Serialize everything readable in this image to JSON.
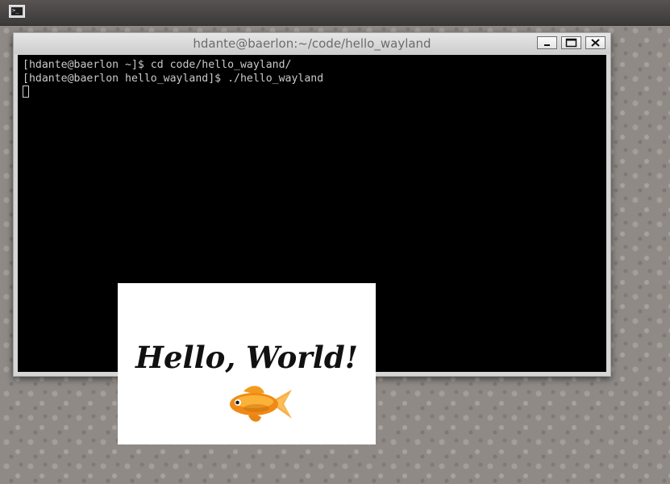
{
  "panel": {
    "launcher_glyph": ">_",
    "launcher_icon": "terminal-icon"
  },
  "terminal_window": {
    "title": "hdante@baerlon:~/code/hello_wayland",
    "buttons": {
      "minimize_icon": "minimize-icon",
      "maximize_icon": "maximize-icon",
      "close_icon": "close-icon"
    },
    "lines": [
      "[hdante@baerlon ~]$ cd code/hello_wayland/",
      "[hdante@baerlon hello_wayland]$ ./hello_wayland"
    ]
  },
  "hello_window": {
    "text": "Hello, World!",
    "image_icon": "goldfish-icon"
  },
  "colors": {
    "terminal_bg": "#000000",
    "terminal_fg": "#c9c9c9",
    "titlebar_text": "#6b6b6b",
    "hello_bg": "#ffffff"
  }
}
